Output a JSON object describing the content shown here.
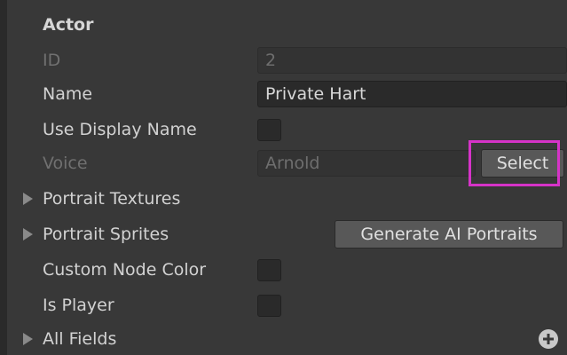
{
  "section": {
    "title": "Actor"
  },
  "fields": {
    "id": {
      "label": "ID",
      "value": "2"
    },
    "name": {
      "label": "Name",
      "value": "Private Hart"
    },
    "use_display_name": {
      "label": "Use Display Name",
      "checked": false
    },
    "voice": {
      "label": "Voice",
      "value": "Arnold",
      "button_label": "Select"
    },
    "portrait_textures": {
      "label": "Portrait Textures",
      "expanded": false
    },
    "portrait_sprites": {
      "label": "Portrait Sprites",
      "expanded": false,
      "button_label": "Generate AI Portraits"
    },
    "custom_node_color": {
      "label": "Custom Node Color",
      "checked": false
    },
    "is_player": {
      "label": "Is Player",
      "checked": false
    },
    "all_fields": {
      "label": "All Fields",
      "expanded": false
    }
  },
  "icons": {
    "foldout": "triangle-right-icon",
    "add": "plus-circle-icon"
  },
  "colors": {
    "background": "#383838",
    "field_background": "#2a2a2a",
    "button_background": "#585858",
    "highlight": "#d633c8",
    "text": "#d2d2d2",
    "disabled_text": "#707070"
  }
}
